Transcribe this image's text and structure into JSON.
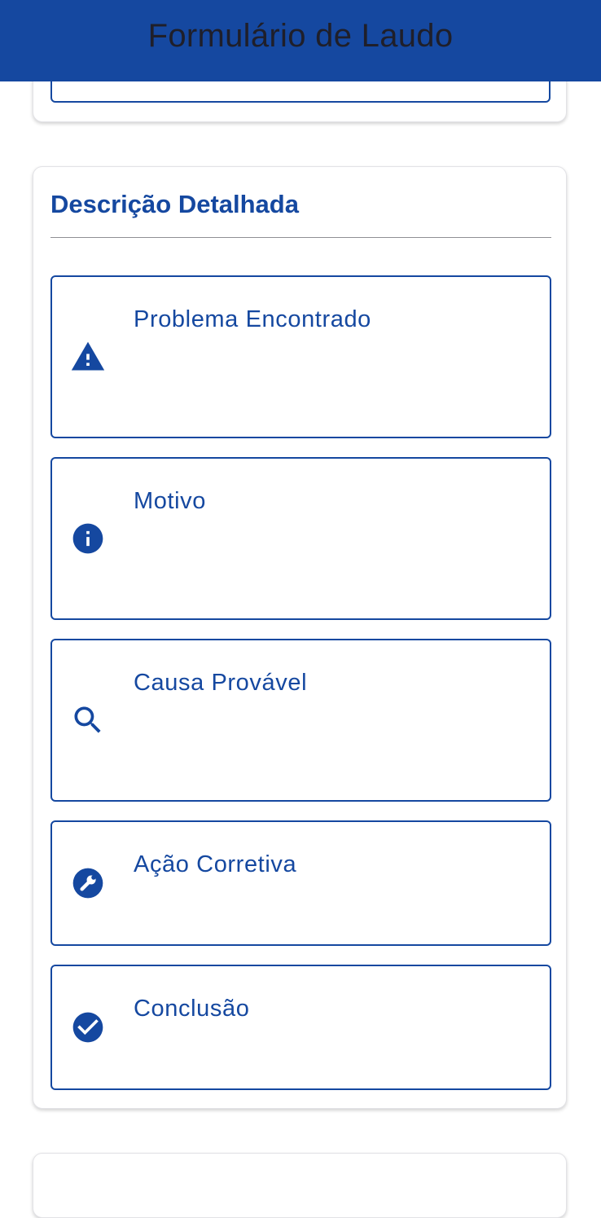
{
  "app_bar": {
    "title": "Formulário de Laudo",
    "color": "#1548a0"
  },
  "section": {
    "title": "Descrição Detalhada"
  },
  "fields": [
    {
      "label": "Problema Encontrado",
      "icon": "warning-icon",
      "value": ""
    },
    {
      "label": "Motivo",
      "icon": "info-icon",
      "value": ""
    },
    {
      "label": "Causa Provável",
      "icon": "search-icon",
      "value": ""
    },
    {
      "label": "Ação Corretiva",
      "icon": "wrench-icon",
      "value": ""
    },
    {
      "label": "Conclusão",
      "icon": "check-circle-icon",
      "value": ""
    }
  ],
  "colors": {
    "primary": "#1548a0",
    "title_text": "#1f1f2a",
    "divider": "#8f8f94"
  }
}
